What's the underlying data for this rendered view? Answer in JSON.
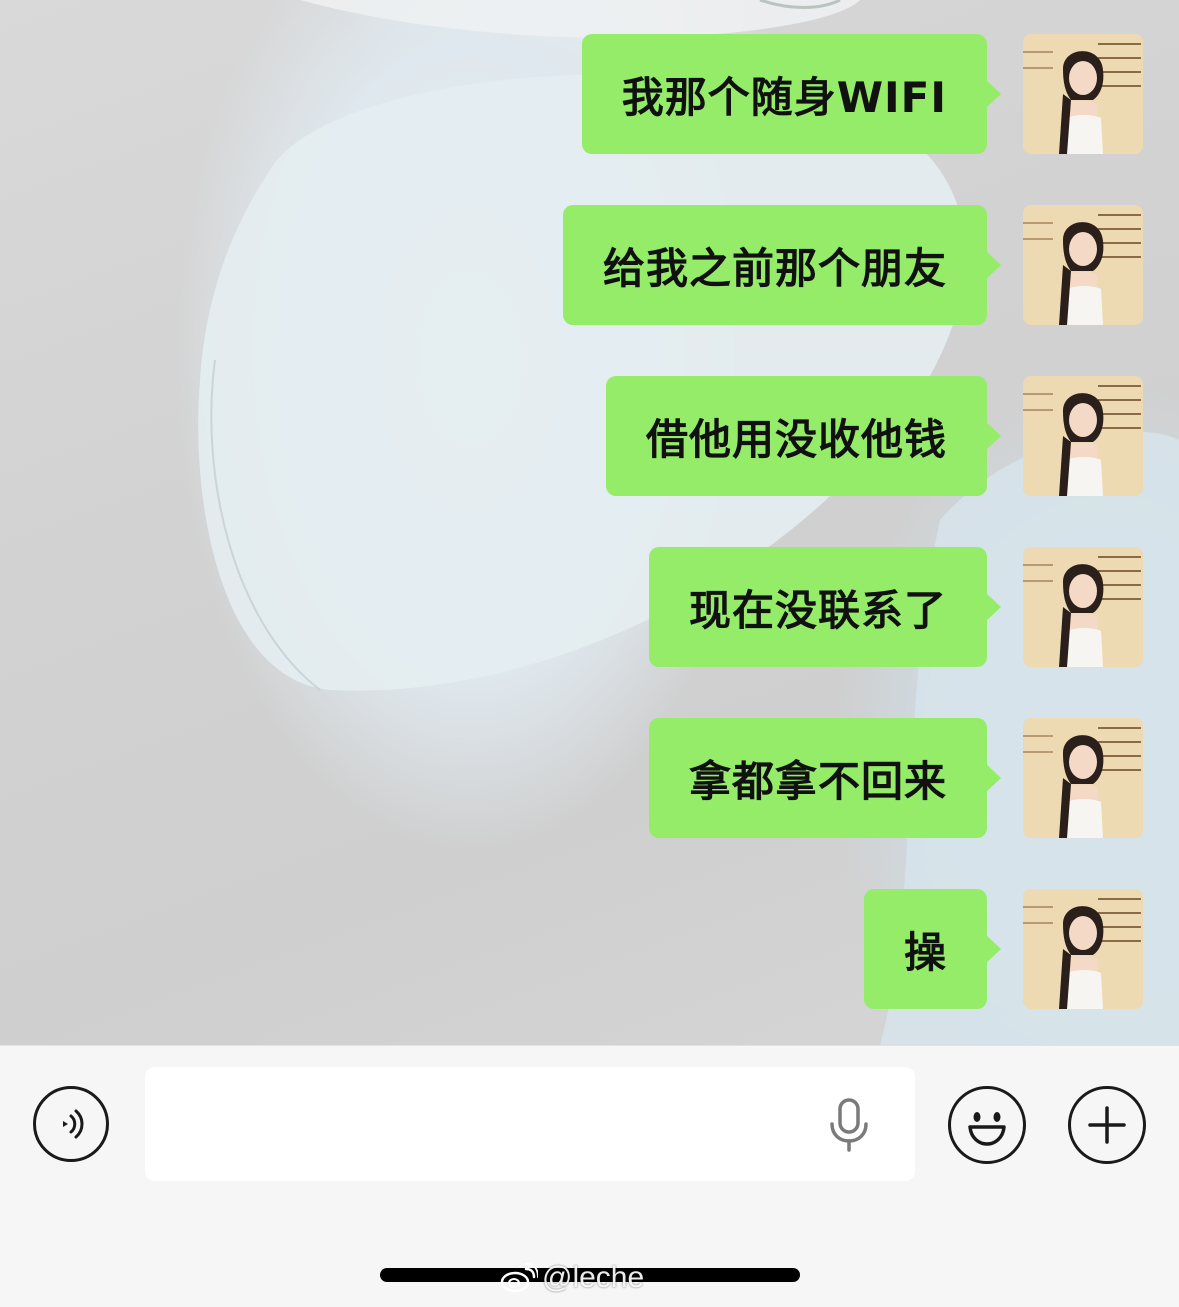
{
  "messages": [
    {
      "text": "我那个随身WIFI"
    },
    {
      "text": "给我之前那个朋友"
    },
    {
      "text": "借他用没收他钱"
    },
    {
      "text": "现在没联系了"
    },
    {
      "text": "拿都拿不回来"
    },
    {
      "text": "操"
    }
  ],
  "input": {
    "value": "",
    "placeholder": ""
  },
  "icons": {
    "voice": "voice-toggle-icon",
    "mic": "microphone-icon",
    "emoji": "emoji-icon",
    "plus": "plus-icon"
  },
  "watermark": {
    "text": "@leche"
  },
  "colors": {
    "bubble": "#95ec69",
    "input_bar": "#f6f6f6"
  }
}
